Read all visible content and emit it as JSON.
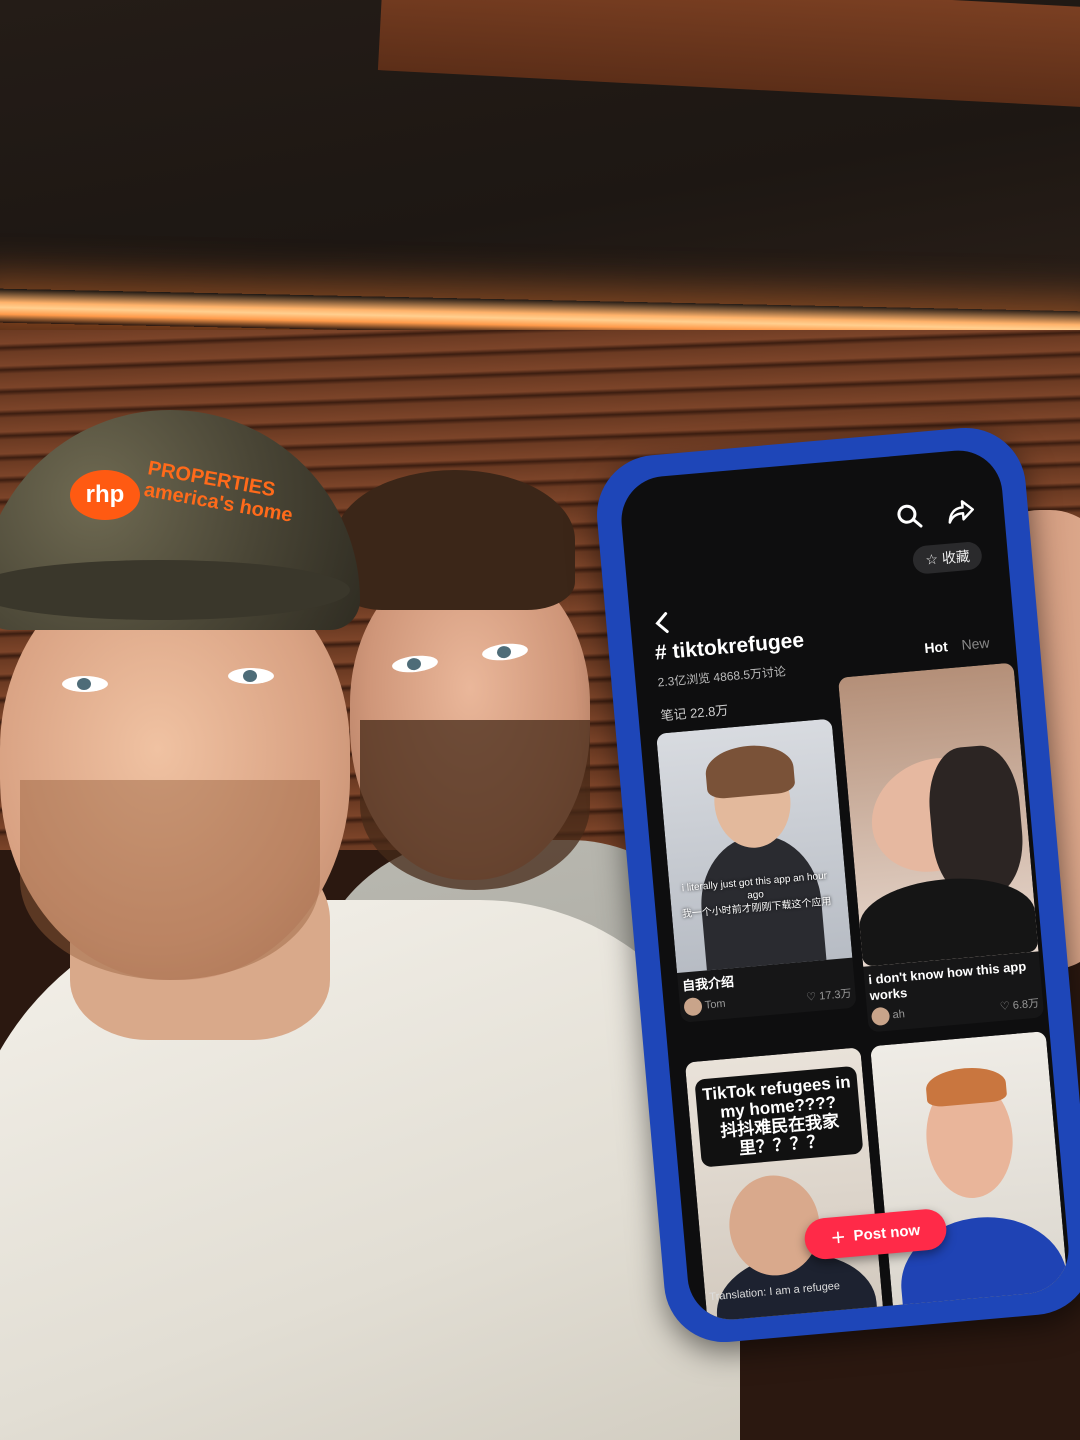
{
  "cap": {
    "logo": "rhp",
    "line1": "PROPERTIES",
    "line2": "america's home"
  },
  "phone": {
    "hashtag": "# tiktokrefugee",
    "subline": "2.3亿浏览   4868.5万讨论",
    "favorite_label": "收藏",
    "sort": {
      "hot": "Hot",
      "new": "New"
    },
    "count": "笔记 22.8万",
    "cards": [
      {
        "caption_overlay": "i literally just got this app an hour ago\n我一个小时前才刚刚下载这个应用",
        "title": "自我介绍",
        "user": "Tom",
        "likes": "17.3万"
      },
      {
        "title": "i don't know how this app works",
        "user": "ah",
        "likes": "6.8万"
      },
      {
        "overlay_text": "TikTok refugees in my home????\n抖抖难民在我家里？？？？"
      },
      {
        "overlay_text": ""
      }
    ],
    "post_button": "Post now",
    "bottom_text": "Translation: I am a refugee"
  },
  "icons": {
    "search": "search-icon",
    "share": "share-icon",
    "back": "back-arrow-icon",
    "star": "star-icon",
    "heart": "heart-icon",
    "plus": "plus-icon"
  },
  "colors": {
    "accent": "#ff2a48",
    "phone_case": "#1e46b8",
    "cap_logo": "#ff5a12"
  }
}
